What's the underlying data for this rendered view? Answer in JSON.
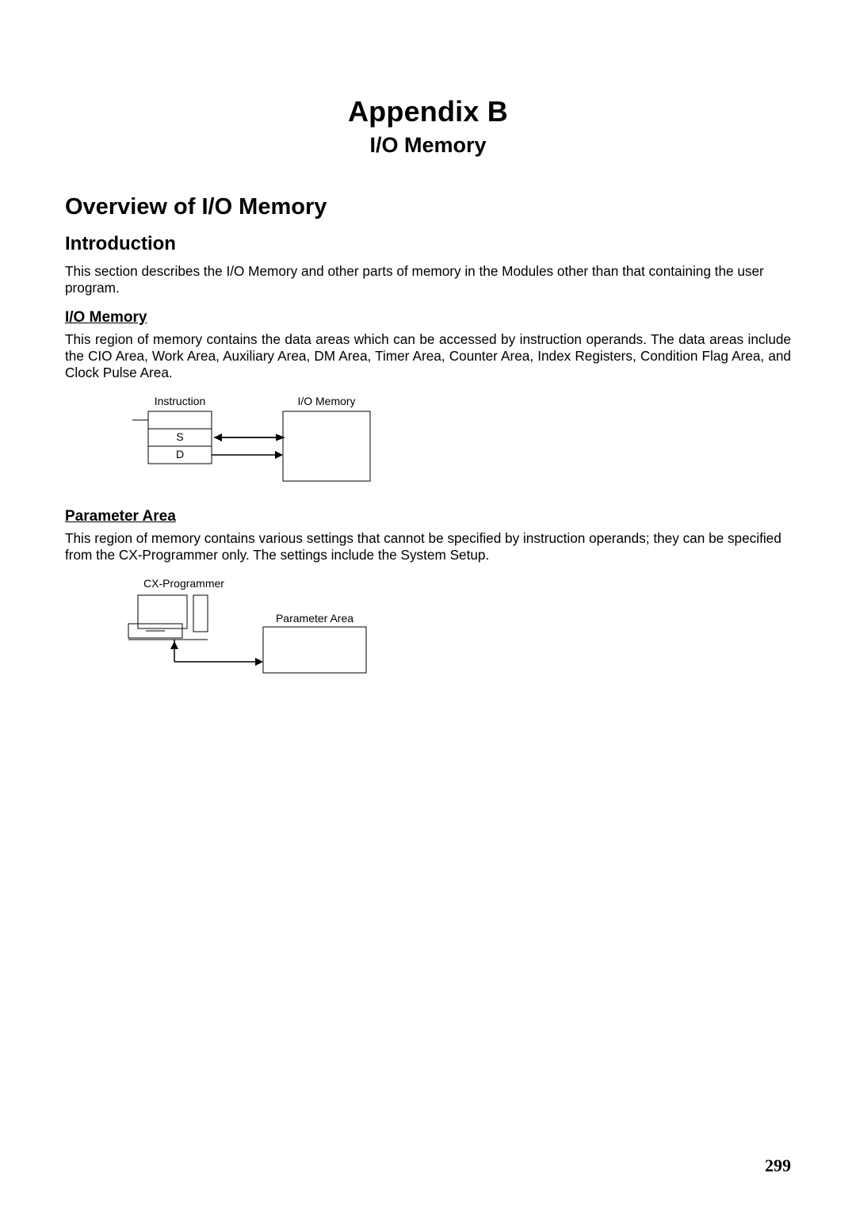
{
  "appendix": {
    "title": "Appendix B",
    "subtitle": "I/O Memory"
  },
  "h1": "Overview of I/O Memory",
  "intro": {
    "heading": "Introduction",
    "text": "This section describes the I/O Memory and other parts of memory in the Modules other than that containing the user program."
  },
  "io_mem": {
    "heading": "I/O Memory",
    "text": "This region of memory contains the data areas which can be accessed by instruction operands. The data areas include the CIO Area, Work Area, Auxiliary Area, DM Area, Timer Area, Counter Area, Index Registers, Condition Flag Area, and Clock Pulse Area.",
    "diagram": {
      "instruction_label": "Instruction",
      "io_memory_label": "I/O Memory",
      "s": "S",
      "d": "D"
    }
  },
  "param": {
    "heading": "Parameter Area",
    "text": "This region of memory contains various settings that cannot be specified by instruction operands; they can be specified from the CX-Programmer only. The settings include the System Setup.",
    "diagram": {
      "cx_label": "CX-Programmer",
      "param_label": "Parameter Area"
    }
  },
  "page_number": "299"
}
